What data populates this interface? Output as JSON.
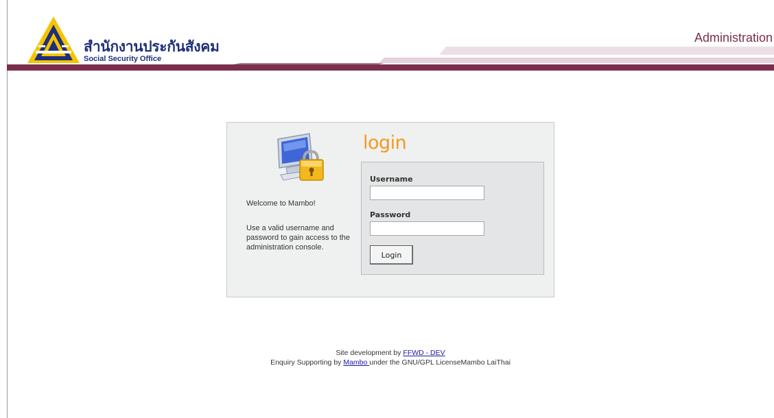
{
  "header": {
    "org_name_thai": "สำนักงานประกันสังคม",
    "org_name_english": "Social Security Office",
    "section_title": "Administration",
    "colors": {
      "logo_yellow": "#f5c400",
      "logo_blue": "#1f2f7a",
      "banner_maroon": "#7a2f4c",
      "banner_pink": "#e6d7de"
    }
  },
  "login": {
    "heading": "login",
    "welcome": "Welcome to Mambo!",
    "instructions": "Use a valid username and password to gain access to the administration console.",
    "username_label": "Username",
    "username_value": "",
    "password_label": "Password",
    "password_value": "",
    "submit_label": "Login",
    "heading_color": "#f29a1c",
    "icon": "computer-lock-icon"
  },
  "footer": {
    "line1_prefix": "Site development by ",
    "line1_link": "FFWD - DEV",
    "line2_prefix": "Enquiry Supporting by ",
    "line2_link": "Mambo ",
    "line2_suffix": "under the GNU/GPL LicenseMambo LaiThai"
  }
}
